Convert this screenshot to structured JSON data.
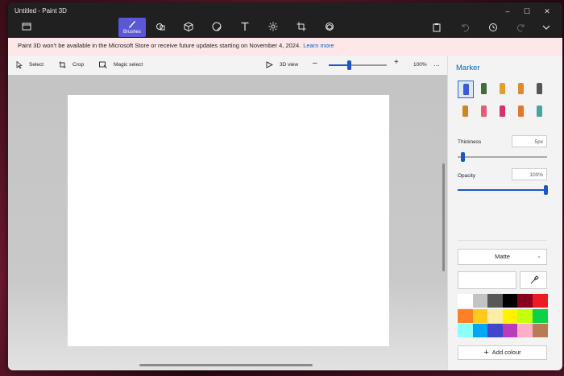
{
  "window": {
    "title": "Untitled - Paint 3D"
  },
  "toolbar": {
    "items": [
      {
        "name": "brushes",
        "label": "Brushes",
        "icon": "brush-icon",
        "active": true
      },
      {
        "name": "2d-shapes",
        "icon": "2d-shapes-icon"
      },
      {
        "name": "3d-shapes",
        "icon": "3d-shapes-icon"
      },
      {
        "name": "stickers",
        "icon": "stickers-icon"
      },
      {
        "name": "text",
        "icon": "text-icon"
      },
      {
        "name": "effects",
        "icon": "effects-icon"
      },
      {
        "name": "canvas",
        "icon": "canvas-icon"
      },
      {
        "name": "3d-library",
        "icon": "3d-library-icon"
      }
    ],
    "right": [
      "paste-icon",
      "undo-icon",
      "history-icon",
      "redo-icon",
      "menu-chevron-icon"
    ]
  },
  "banner": {
    "text": "Paint 3D won't be available in the Microsoft Store or receive future updates starting on November 4, 2024.",
    "link": "Learn more"
  },
  "subtoolbar": {
    "select": "Select",
    "crop": "Crop",
    "magic_select": "Magic select",
    "view3d": "3D view",
    "zoom": "100%",
    "zoom_fraction": 0.35
  },
  "panel": {
    "title": "Marker",
    "thickness_label": "Thickness",
    "thickness_value": "5px",
    "thickness_fraction": 0.05,
    "opacity_label": "Opacity",
    "opacity_value": "100%",
    "opacity_fraction": 1.0,
    "finish": "Matte",
    "add_colour": "Add colour",
    "brushes": [
      "marker-icon",
      "calligraphy-pen-icon",
      "oil-brush-icon",
      "watercolor-icon",
      "pixel-pen-icon",
      "pencil-icon",
      "eraser-icon",
      "crayon-icon",
      "spray-can-icon",
      "fill-icon"
    ],
    "palette": [
      "#ffffff",
      "#c3c3c3",
      "#585858",
      "#000000",
      "#88001b",
      "#ec1c24",
      "#ff7f27",
      "#ffca18",
      "#fdeca6",
      "#fff200",
      "#c4ff0e",
      "#0ed145",
      "#8cfffb",
      "#00a8f3",
      "#3f48cc",
      "#b83dba",
      "#ffaec8",
      "#b97a56"
    ]
  }
}
